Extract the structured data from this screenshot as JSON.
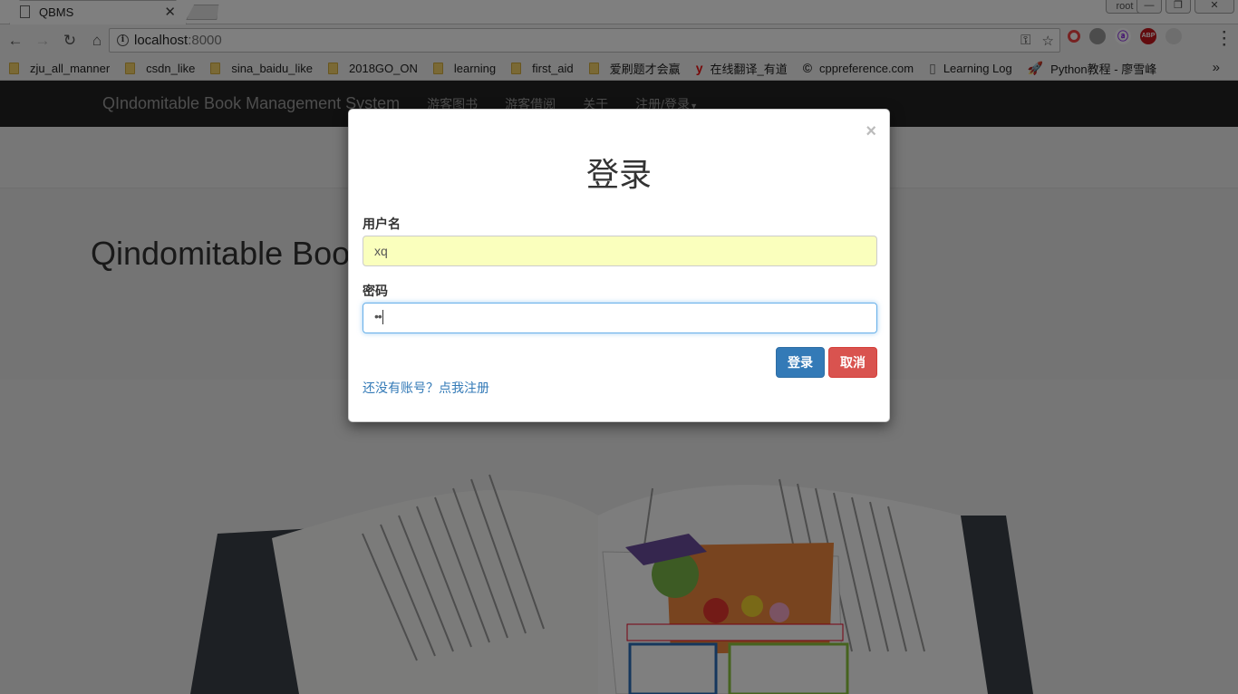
{
  "browser": {
    "tab_title": "QBMS",
    "profile": "root",
    "url_host": "localhost",
    "url_port": ":8000",
    "bookmarks": [
      {
        "label": "zju_all_manner",
        "type": "folder"
      },
      {
        "label": "csdn_like",
        "type": "folder"
      },
      {
        "label": "sina_baidu_like",
        "type": "folder"
      },
      {
        "label": "2018GO_ON",
        "type": "folder"
      },
      {
        "label": "learning",
        "type": "folder"
      },
      {
        "label": "first_aid",
        "type": "folder"
      },
      {
        "label": "爱刷题才会赢",
        "type": "folder"
      },
      {
        "label": "在线翻译_有道",
        "type": "youdao"
      },
      {
        "label": "cppreference.com",
        "type": "cpp"
      },
      {
        "label": "Learning Log",
        "type": "page"
      },
      {
        "label": "Python教程 - 廖雪峰",
        "type": "rocket"
      }
    ],
    "bookmarks_more": "»"
  },
  "app": {
    "brand": "QIndomitable Book Management System",
    "nav": [
      "游客图书",
      "游客借阅",
      "关于",
      "注册/登录"
    ],
    "hero_title": "Qindomitable Boo"
  },
  "login_modal": {
    "close": "×",
    "title": "登录",
    "username_label": "用户名",
    "username_value": "xq",
    "password_label": "密码",
    "password_value": "••",
    "login_button": "登录",
    "cancel_button": "取消",
    "register_link": "还没有账号？点我注册"
  },
  "colors": {
    "primary": "#337ab7",
    "danger": "#d9534f",
    "navbar": "#222222",
    "autofill": "#faffbd"
  }
}
